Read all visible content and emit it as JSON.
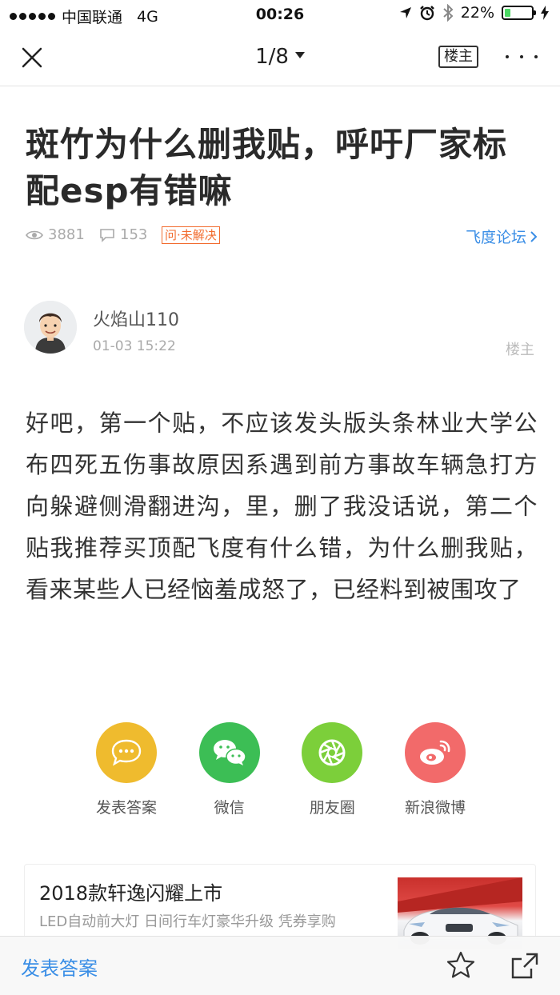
{
  "status_bar": {
    "carrier": "中国联通",
    "network": "4G",
    "time": "00:26",
    "battery_percent": "22%",
    "battery_level": 0.22,
    "icons": [
      "location-arrow-icon",
      "alarm-icon",
      "bluetooth-icon",
      "battery-icon"
    ]
  },
  "nav": {
    "page_indicator": "1/8",
    "owner_button": "楼主",
    "icons": [
      "close-icon",
      "more-icon",
      "caret-down-icon"
    ]
  },
  "post": {
    "title": "斑竹为什么删我贴，呼吁厂家标配esp有错嘛",
    "views": "3881",
    "comments": "153",
    "status_tag": "问·未解决",
    "forum": "飞度论坛",
    "author": {
      "name": "火焰山110",
      "time": "01-03 15:22",
      "role": "楼主"
    },
    "body": "好吧，第一个贴，不应该发头版头条林业大学公布四死五伤事故原因系遇到前方事故车辆急打方向躲避侧滑翻进沟，里，删了我没话说，第二个贴我推荐买顶配飞度有什么错，为什么删我贴，看来某些人已经恼羞成怒了，已经料到被围攻了"
  },
  "share": [
    {
      "label": "发表答案",
      "icon": "comment-bubble-icon",
      "color": "#efbb2e"
    },
    {
      "label": "微信",
      "icon": "wechat-icon",
      "color": "#3cbe55"
    },
    {
      "label": "朋友圈",
      "icon": "moments-icon",
      "color": "#7ccf3a"
    },
    {
      "label": "新浪微博",
      "icon": "weibo-icon",
      "color": "#f26a6a"
    }
  ],
  "ad": {
    "title": "2018款轩逸闪耀上市",
    "description": "LED自动前大灯 日间行车灯豪华升级 凭券享购"
  },
  "bottom_bar": {
    "answer_label": "发表答案",
    "icons": [
      "star-icon",
      "share-icon"
    ]
  }
}
